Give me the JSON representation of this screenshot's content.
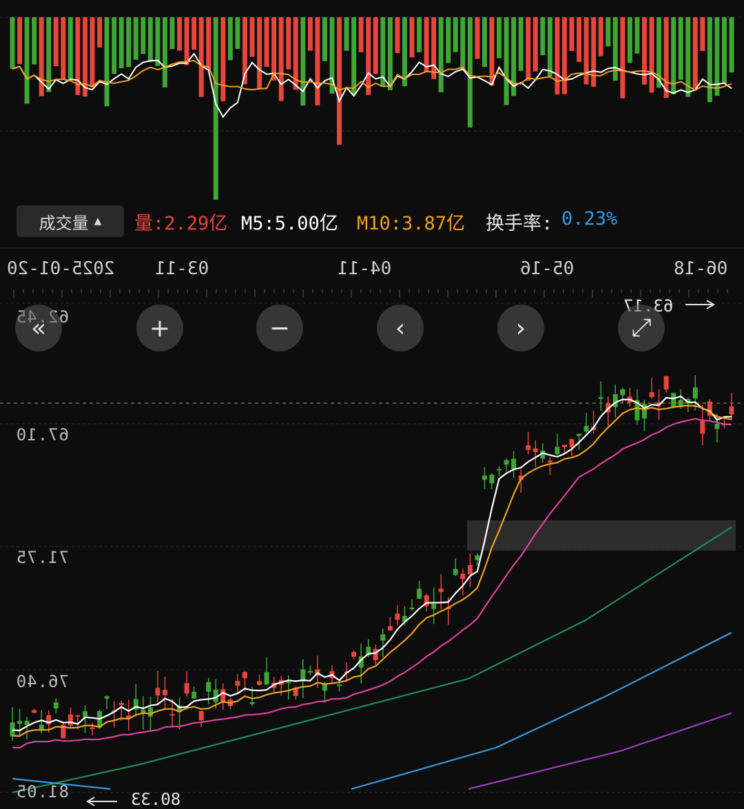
{
  "volume_bar": {
    "selector_label": "成交量",
    "volume_text": "量:2.29亿",
    "m5_text": "M5:5.00亿",
    "m10_text": "M10:3.87亿",
    "turnover_label": "换手率:",
    "turnover_value": "0.23%"
  },
  "dates": [
    "2025-01-20",
    "03-11",
    "04-11",
    "05-16",
    "06-18"
  ],
  "price_labels": [
    "81.05",
    "76.40",
    "71.75",
    "67.10",
    "62.45"
  ],
  "annotations": {
    "high": "63.17",
    "low": "80.33"
  },
  "controls": [
    {
      "name": "collapse-left-button",
      "glyph": "«"
    },
    {
      "name": "zoom-in-button",
      "glyph": "+"
    },
    {
      "name": "zoom-out-button",
      "glyph": "−"
    },
    {
      "name": "scroll-left-button",
      "glyph": "‹"
    },
    {
      "name": "scroll-right-button",
      "glyph": "›"
    },
    {
      "name": "fullscreen-button",
      "glyph": "⤢"
    }
  ],
  "colors": {
    "up": "#e8453c",
    "down": "#3fa535",
    "ma5": "#ffffff",
    "ma10": "#f0a020",
    "ma20": "#e040a0",
    "ma60": "#1e8c5a",
    "ma120": "#3a9ae0",
    "ma250": "#9b3fc0",
    "turnover": "#2f9be8"
  }
}
